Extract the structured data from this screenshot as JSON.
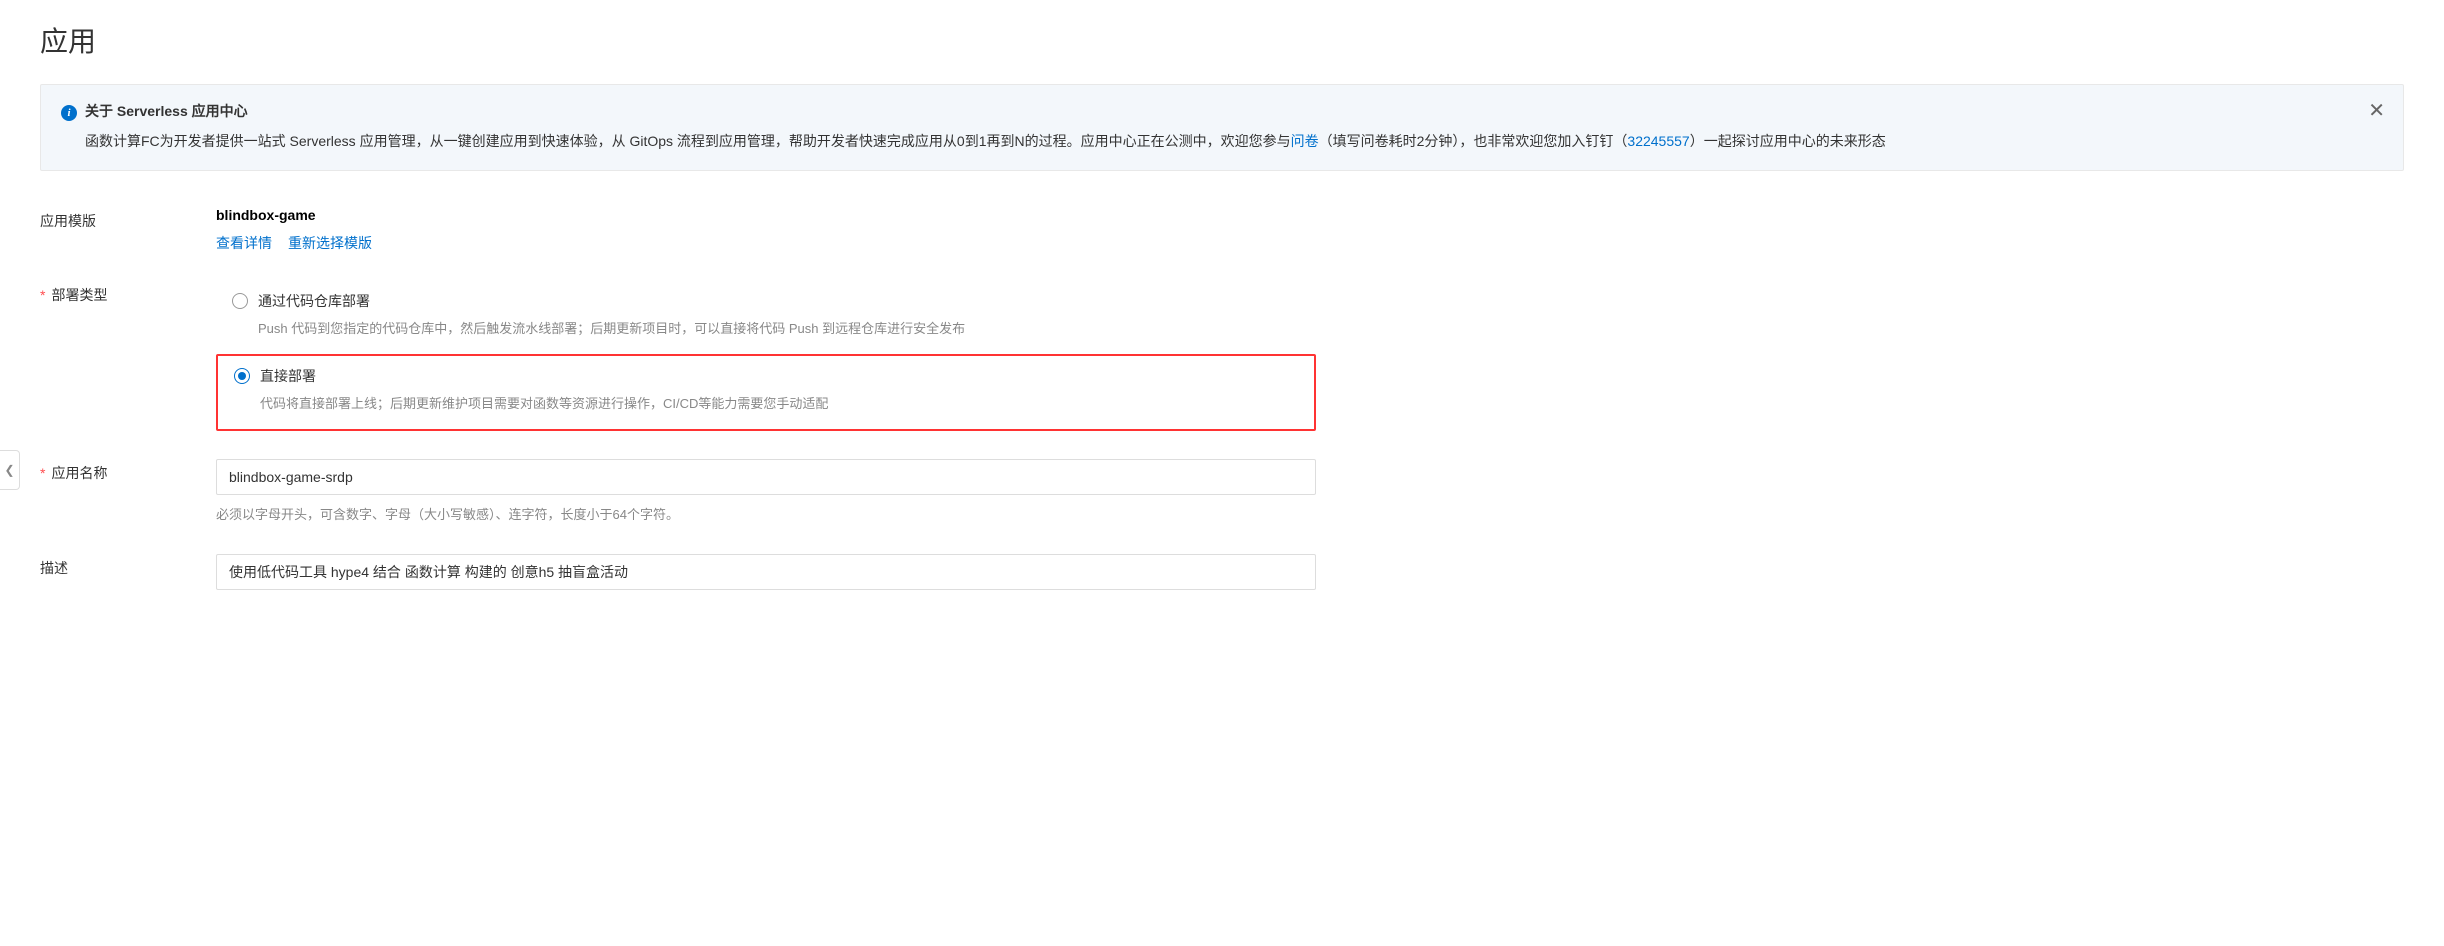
{
  "page_title": "应用",
  "banner": {
    "title": "关于 Serverless 应用中心",
    "body_prefix": "函数计算FC为开发者提供一站式 Serverless 应用管理，从一键创建应用到快速体验，从 GitOps 流程到应用管理，帮助开发者快速完成应用从0到1再到N的过程。应用中心正在公测中，欢迎您参与",
    "survey_link": "问卷",
    "body_mid": "（填写问卷耗时2分钟），也非常欢迎您加入钉钉（",
    "dingtalk_link": "32245557",
    "body_suffix": "）一起探讨应用中心的未来形态"
  },
  "form": {
    "template": {
      "label": "应用模版",
      "value": "blindbox-game",
      "view_details": "查看详情",
      "reselect": "重新选择模版"
    },
    "deploy_type": {
      "label": "部署类型",
      "options": [
        {
          "label": "通过代码仓库部署",
          "desc": "Push 代码到您指定的代码仓库中，然后触发流水线部署；后期更新项目时，可以直接将代码 Push 到远程仓库进行安全发布"
        },
        {
          "label": "直接部署",
          "desc": "代码将直接部署上线；后期更新维护项目需要对函数等资源进行操作，CI/CD等能力需要您手动适配"
        }
      ]
    },
    "app_name": {
      "label": "应用名称",
      "value": "blindbox-game-srdp",
      "hint": "必须以字母开头，可含数字、字母（大小写敏感）、连字符，长度小于64个字符。"
    },
    "description": {
      "label": "描述",
      "value": "使用低代码工具 hype4 结合 函数计算 构建的 创意h5 抽盲盒活动"
    }
  }
}
